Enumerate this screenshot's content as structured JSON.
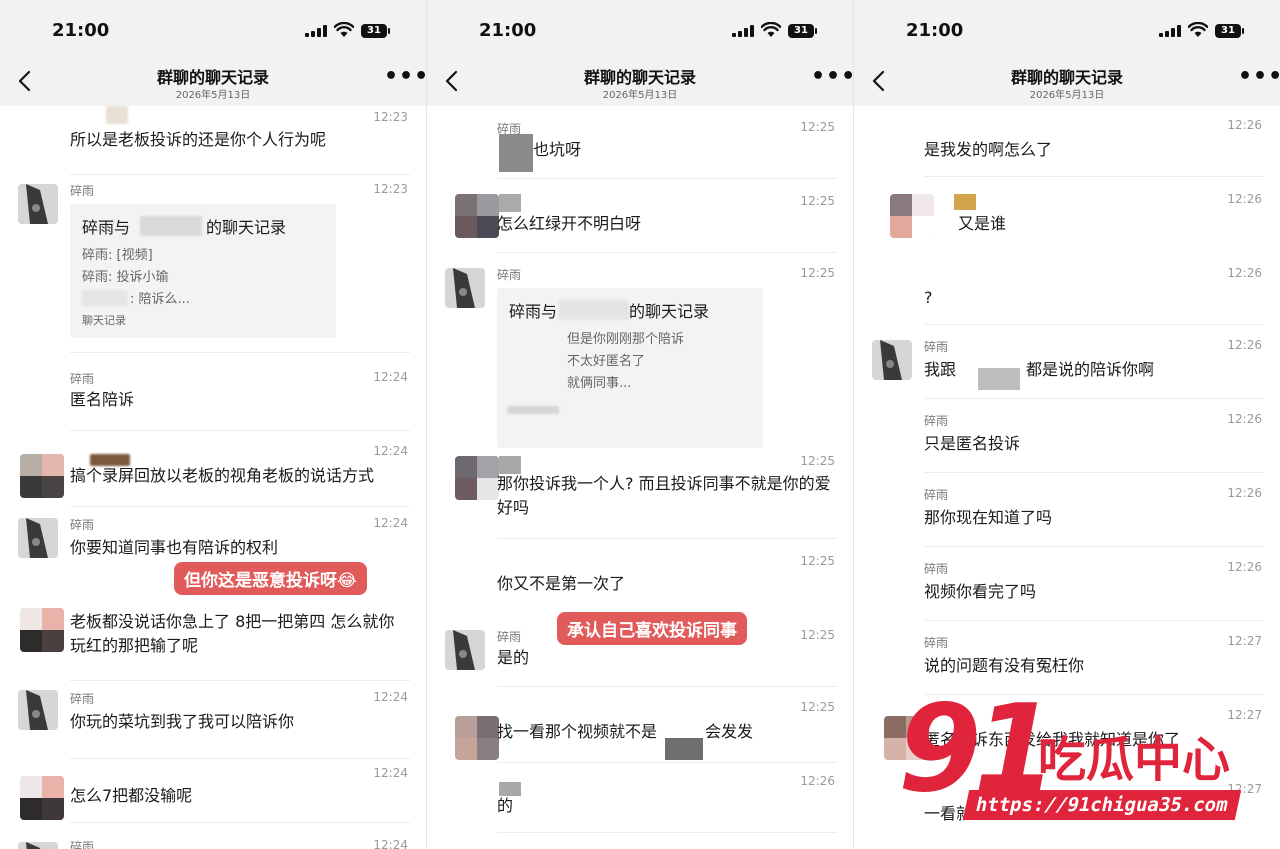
{
  "status_bar": {
    "time": "21:00",
    "battery": "31"
  },
  "header": {
    "title": "群聊的聊天记录",
    "date": "2026年5月13日",
    "more": "•••"
  },
  "panels": [
    {
      "messages": [
        {
          "time": "12:23",
          "text": "所以是老板投诉的还是你个人行为呢"
        },
        {
          "sender": "碎雨",
          "time": "12:23",
          "card": {
            "title_left": "碎雨与",
            "title_right": "的聊天记录",
            "lines": [
              "碎雨: [视频]",
              "碎雨: 投诉小瑜",
              ": 陪诉么..."
            ],
            "footer": "聊天记录"
          }
        },
        {
          "sender": "碎雨",
          "time": "12:24",
          "text": "匿名陪诉"
        },
        {
          "time": "12:24",
          "text": "搞个录屏回放以老板的视角老板的说话方式"
        },
        {
          "sender": "碎雨",
          "time": "12:24",
          "text": "你要知道同事也有陪诉的权利"
        },
        {
          "text": "老板都没说话你急上了 8把一把第四 怎么就你玩红的那把输了呢"
        },
        {
          "sender": "碎雨",
          "time": "12:24",
          "text": "你玩的菜坑到我了我可以陪诉你"
        },
        {
          "time": "12:24",
          "text": "怎么7把都没输呢"
        },
        {
          "sender": "碎雨",
          "time": "12:24"
        }
      ],
      "caption": "但你这是恶意投诉呀😂"
    },
    {
      "messages": [
        {
          "sender": "碎雨",
          "time": "12:25",
          "text": "也坑呀"
        },
        {
          "time": "12:25",
          "text": "怎么红绿开不明白呀"
        },
        {
          "sender": "碎雨",
          "time": "12:25",
          "card": {
            "title_left": "碎雨与",
            "title_right": "的聊天记录",
            "lines": [
              "但是你刚刚那个陪诉",
              "不太好匿名了",
              "就俩同事..."
            ]
          }
        },
        {
          "time": "12:25",
          "text": "那你投诉我一个人? 而且投诉同事不就是你的爱好吗"
        },
        {
          "time": "12:25",
          "text": "你又不是第一次了"
        },
        {
          "sender": "碎雨",
          "time": "12:25",
          "text": "是的"
        },
        {
          "time": "12:25",
          "text_left": "找一看那个视频就不是",
          "text_right": "会发发"
        },
        {
          "time": "12:26",
          "text": "的"
        }
      ],
      "caption": "承认自己喜欢投诉同事"
    },
    {
      "messages": [
        {
          "time": "12:26",
          "text": "是我发的啊怎么了"
        },
        {
          "time": "12:26",
          "text": "又是谁"
        },
        {
          "time": "12:26",
          "text": "?"
        },
        {
          "sender": "碎雨",
          "time": "12:26",
          "text_left": "我跟",
          "text_right": "都是说的陪诉你啊"
        },
        {
          "sender": "碎雨",
          "time": "12:26",
          "text": "只是匿名投诉"
        },
        {
          "sender": "碎雨",
          "time": "12:26",
          "text": "那你现在知道了吗"
        },
        {
          "sender": "碎雨",
          "time": "12:26",
          "text": "视频你看完了吗"
        },
        {
          "sender": "碎雨",
          "time": "12:27",
          "text": "说的问题有没有冤枉你"
        },
        {
          "time": "12:27",
          "text": "匿名投诉东西发给我我就知道是你了"
        },
        {
          "time": "12:27",
          "text": "一看就"
        }
      ]
    }
  ],
  "watermark": {
    "number": "91",
    "brand": "吃瓜中心",
    "url": "https://91chigua35.com"
  },
  "colors": {
    "caption_bg": "#e25b5b",
    "watermark": "#e0243b"
  }
}
